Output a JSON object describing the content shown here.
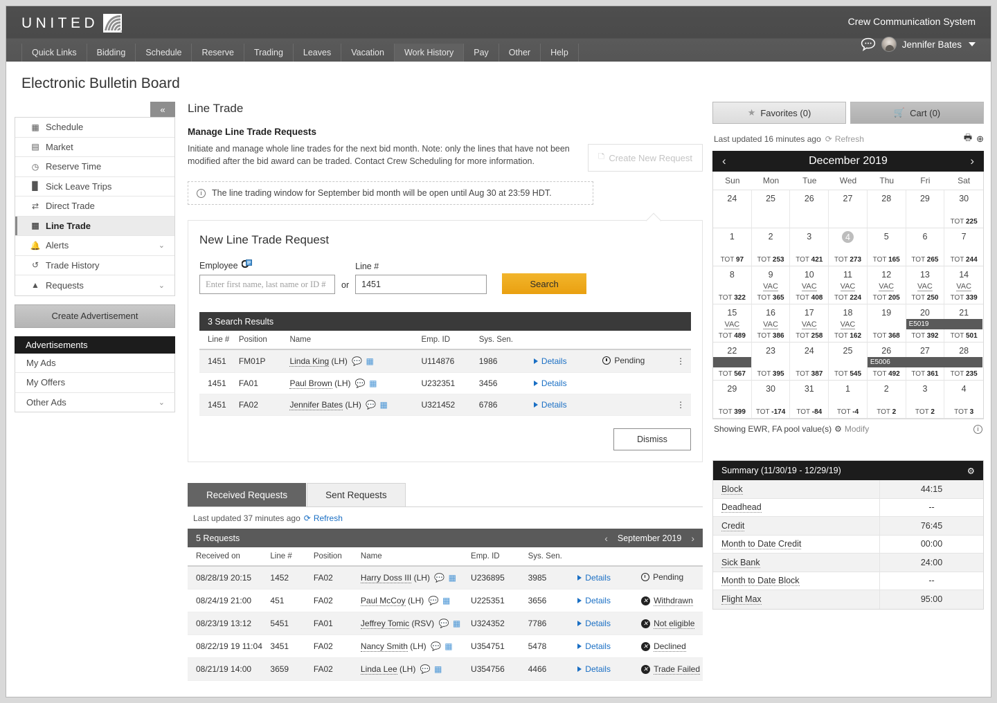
{
  "header": {
    "brand": "UNITED",
    "system_title": "Crew Communication System",
    "user_name": "Jennifer Bates",
    "nav": [
      {
        "label": "Quick Links",
        "active": false
      },
      {
        "label": "Bidding",
        "active": false
      },
      {
        "label": "Schedule",
        "active": false
      },
      {
        "label": "Reserve",
        "active": false
      },
      {
        "label": "Trading",
        "active": false
      },
      {
        "label": "Leaves",
        "active": false
      },
      {
        "label": "Vacation",
        "active": false
      },
      {
        "label": "Work History",
        "active": true
      },
      {
        "label": "Pay",
        "active": false
      },
      {
        "label": "Other",
        "active": false
      },
      {
        "label": "Help",
        "active": false
      }
    ]
  },
  "page_title": "Electronic Bulletin Board",
  "sidebar": {
    "collapse_label": "«",
    "items": [
      {
        "label": "Schedule",
        "icon": "calendar-icon",
        "chevron": false,
        "active": false
      },
      {
        "label": "Market",
        "icon": "store-icon",
        "chevron": false,
        "active": false
      },
      {
        "label": "Reserve Time",
        "icon": "clock-icon",
        "chevron": false,
        "active": false
      },
      {
        "label": "Sick Leave Trips",
        "icon": "medical-bag-icon",
        "chevron": false,
        "active": false
      },
      {
        "label": "Direct Trade",
        "icon": "swap-arrows-icon",
        "chevron": false,
        "active": false
      },
      {
        "label": "Line Trade",
        "icon": "calendar-icon",
        "chevron": false,
        "active": true
      },
      {
        "label": "Alerts",
        "icon": "bell-icon",
        "chevron": true,
        "active": false
      },
      {
        "label": "Trade History",
        "icon": "history-icon",
        "chevron": false,
        "active": false
      },
      {
        "label": "Requests",
        "icon": "bell-service-icon",
        "chevron": true,
        "active": false
      }
    ],
    "create_ad_label": "Create Advertisement",
    "ads_header": "Advertisements",
    "ads_items": [
      {
        "label": "My Ads",
        "chevron": false
      },
      {
        "label": "My Offers",
        "chevron": false
      },
      {
        "label": "Other Ads",
        "chevron": true
      }
    ]
  },
  "main": {
    "title": "Line Trade",
    "subtitle": "Manage Line Trade Requests",
    "description": "Initiate and manage whole line trades for the next bid month. Note: only the lines that have not been modified after the bid award can be traded. Contact Crew Scheduling for more information.",
    "create_request_label": "Create New Request",
    "info_banner": "The line trading window for September bid month will be open until Aug 30 at 23:59 HDT.",
    "new_request": {
      "panel_title": "New Line Trade Request",
      "employee_label": "Employee",
      "employee_placeholder": "Enter first name, last name or ID #",
      "employee_value": "",
      "or_label": "or",
      "line_label": "Line #",
      "line_value": "1451",
      "search_label": "Search",
      "dismiss_label": "Dismiss"
    },
    "search_results": {
      "count_label": "3 Search Results",
      "columns": [
        "Line #",
        "Position",
        "Name",
        "Emp. ID",
        "Sys. Sen."
      ],
      "rows": [
        {
          "line": "1451",
          "position": "FM01P",
          "name": "Linda King",
          "qual": "(LH)",
          "emp_id": "U114876",
          "sen": "1986",
          "details": "Details",
          "status": "Pending",
          "status_icon": "clock-icon",
          "kebab": true
        },
        {
          "line": "1451",
          "position": "FA01",
          "name": "Paul Brown",
          "qual": "(LH)",
          "emp_id": "U232351",
          "sen": "3456",
          "details": "Details",
          "status": "",
          "status_icon": "",
          "kebab": false
        },
        {
          "line": "1451",
          "position": "FA02",
          "name": "Jennifer Bates",
          "qual": "(LH)",
          "emp_id": "U321452",
          "sen": "6786",
          "details": "Details",
          "status": "",
          "status_icon": "",
          "kebab": true
        }
      ]
    },
    "requests": {
      "tabs": [
        {
          "label": "Received Requests",
          "active": true
        },
        {
          "label": "Sent Requests",
          "active": false
        }
      ],
      "last_updated": "Last updated 37 minutes ago",
      "refresh_label": "Refresh",
      "count_label": "5 Requests",
      "month_label": "September 2019",
      "columns": [
        "Received on",
        "Line #",
        "Position",
        "Name",
        "Emp. ID",
        "Sys. Sen."
      ],
      "rows": [
        {
          "received": "08/28/19 20:15",
          "line": "1452",
          "position": "FA02",
          "name": "Harry Doss III",
          "qual": "(LH)",
          "emp_id": "U236895",
          "sen": "3985",
          "details": "Details",
          "status": "Pending",
          "status_icon": "clock-icon",
          "underline": false
        },
        {
          "received": "08/24/19 21:00",
          "line": "451",
          "position": "FA02",
          "name": "Paul McCoy",
          "qual": "(LH)",
          "emp_id": "U225351",
          "sen": "3656",
          "details": "Details",
          "status": "Withdrawn",
          "status_icon": "x-circle-icon",
          "underline": true
        },
        {
          "received": "08/23/19 13:12",
          "line": "5451",
          "position": "FA01",
          "name": "Jeffrey Tomic",
          "qual": "(RSV)",
          "emp_id": "U324352",
          "sen": "7786",
          "details": "Details",
          "status": "Not eligible",
          "status_icon": "x-circle-icon",
          "underline": true
        },
        {
          "received": "08/22/19 19 11:04",
          "line": "3451",
          "position": "FA02",
          "name": "Nancy Smith",
          "qual": "(LH)",
          "emp_id": "U354751",
          "sen": "5478",
          "details": "Details",
          "status": "Declined",
          "status_icon": "x-circle-icon",
          "underline": true
        },
        {
          "received": "08/21/19 14:00",
          "line": "3659",
          "position": "FA02",
          "name": "Linda Lee",
          "qual": "(LH)",
          "emp_id": "U354756",
          "sen": "4466",
          "details": "Details",
          "status": "Trade Failed",
          "status_icon": "x-circle-icon",
          "underline": true
        }
      ]
    }
  },
  "right": {
    "favorites_label": "Favorites (0)",
    "cart_label": "Cart (0)",
    "last_updated": "Last updated 16 minutes ago",
    "refresh_label": "Refresh",
    "calendar": {
      "month_label": "December 2019",
      "dows": [
        "Sun",
        "Mon",
        "Tue",
        "Wed",
        "Thu",
        "Fri",
        "Sat"
      ],
      "cells": [
        {
          "day": "24",
          "tot": "",
          "vac": false,
          "selected": false,
          "pairing": ""
        },
        {
          "day": "25",
          "tot": "",
          "vac": false,
          "selected": false,
          "pairing": ""
        },
        {
          "day": "26",
          "tot": "",
          "vac": false,
          "selected": false,
          "pairing": ""
        },
        {
          "day": "27",
          "tot": "",
          "vac": false,
          "selected": false,
          "pairing": ""
        },
        {
          "day": "28",
          "tot": "",
          "vac": false,
          "selected": false,
          "pairing": ""
        },
        {
          "day": "29",
          "tot": "",
          "vac": false,
          "selected": false,
          "pairing": ""
        },
        {
          "day": "30",
          "tot": "225",
          "vac": false,
          "selected": false,
          "pairing": ""
        },
        {
          "day": "1",
          "tot": "97",
          "vac": false,
          "selected": false,
          "pairing": ""
        },
        {
          "day": "2",
          "tot": "253",
          "vac": false,
          "selected": false,
          "pairing": ""
        },
        {
          "day": "3",
          "tot": "421",
          "vac": false,
          "selected": false,
          "pairing": ""
        },
        {
          "day": "4",
          "tot": "273",
          "vac": false,
          "selected": true,
          "pairing": ""
        },
        {
          "day": "5",
          "tot": "165",
          "vac": false,
          "selected": false,
          "pairing": ""
        },
        {
          "day": "6",
          "tot": "265",
          "vac": false,
          "selected": false,
          "pairing": ""
        },
        {
          "day": "7",
          "tot": "244",
          "vac": false,
          "selected": false,
          "pairing": ""
        },
        {
          "day": "8",
          "tot": "322",
          "vac": false,
          "selected": false,
          "pairing": ""
        },
        {
          "day": "9",
          "tot": "365",
          "vac": true,
          "selected": false,
          "pairing": ""
        },
        {
          "day": "10",
          "tot": "408",
          "vac": true,
          "selected": false,
          "pairing": ""
        },
        {
          "day": "11",
          "tot": "224",
          "vac": true,
          "selected": false,
          "pairing": ""
        },
        {
          "day": "12",
          "tot": "205",
          "vac": true,
          "selected": false,
          "pairing": ""
        },
        {
          "day": "13",
          "tot": "250",
          "vac": true,
          "selected": false,
          "pairing": ""
        },
        {
          "day": "14",
          "tot": "339",
          "vac": true,
          "selected": false,
          "pairing": ""
        },
        {
          "day": "15",
          "tot": "489",
          "vac": true,
          "selected": false,
          "pairing": ""
        },
        {
          "day": "16",
          "tot": "386",
          "vac": true,
          "selected": false,
          "pairing": ""
        },
        {
          "day": "17",
          "tot": "258",
          "vac": true,
          "selected": false,
          "pairing": ""
        },
        {
          "day": "18",
          "tot": "162",
          "vac": true,
          "selected": false,
          "pairing": ""
        },
        {
          "day": "19",
          "tot": "368",
          "vac": false,
          "selected": false,
          "pairing": ""
        },
        {
          "day": "20",
          "tot": "392",
          "vac": false,
          "selected": false,
          "pairing": "E5019"
        },
        {
          "day": "21",
          "tot": "501",
          "vac": false,
          "selected": false,
          "pairing": "cont"
        },
        {
          "day": "22",
          "tot": "567",
          "vac": false,
          "selected": false,
          "pairing": "blank"
        },
        {
          "day": "23",
          "tot": "395",
          "vac": false,
          "selected": false,
          "pairing": ""
        },
        {
          "day": "24",
          "tot": "387",
          "vac": false,
          "selected": false,
          "pairing": ""
        },
        {
          "day": "25",
          "tot": "545",
          "vac": false,
          "selected": false,
          "pairing": ""
        },
        {
          "day": "26",
          "tot": "492",
          "vac": false,
          "selected": false,
          "pairing": "E5006"
        },
        {
          "day": "27",
          "tot": "361",
          "vac": false,
          "selected": false,
          "pairing": "cont"
        },
        {
          "day": "28",
          "tot": "235",
          "vac": false,
          "selected": false,
          "pairing": "cont"
        },
        {
          "day": "29",
          "tot": "399",
          "vac": false,
          "selected": false,
          "pairing": ""
        },
        {
          "day": "30",
          "tot": "-174",
          "vac": false,
          "selected": false,
          "pairing": ""
        },
        {
          "day": "31",
          "tot": "-84",
          "vac": false,
          "selected": false,
          "pairing": ""
        },
        {
          "day": "1",
          "tot": "-4",
          "vac": false,
          "selected": false,
          "pairing": ""
        },
        {
          "day": "2",
          "tot": "2",
          "vac": false,
          "selected": false,
          "pairing": ""
        },
        {
          "day": "3",
          "tot": "2",
          "vac": false,
          "selected": false,
          "pairing": ""
        },
        {
          "day": "4",
          "tot": "3",
          "vac": false,
          "selected": false,
          "pairing": ""
        }
      ],
      "tot_prefix": "TOT",
      "vac_label": "VAC",
      "footer_text": "Showing EWR, FA pool value(s)",
      "modify_label": "Modify"
    },
    "summary": {
      "title": "Summary (11/30/19 - 12/29/19)",
      "rows": [
        {
          "key": "Block",
          "value": "44:15"
        },
        {
          "key": "Deadhead",
          "value": "--"
        },
        {
          "key": "Credit",
          "value": "76:45"
        },
        {
          "key": "Month to Date Credit",
          "value": "00:00"
        },
        {
          "key": "Sick Bank",
          "value": "24:00"
        },
        {
          "key": "Month to Date Block",
          "value": "--"
        },
        {
          "key": "Flight Max",
          "value": "95:00"
        }
      ]
    }
  }
}
